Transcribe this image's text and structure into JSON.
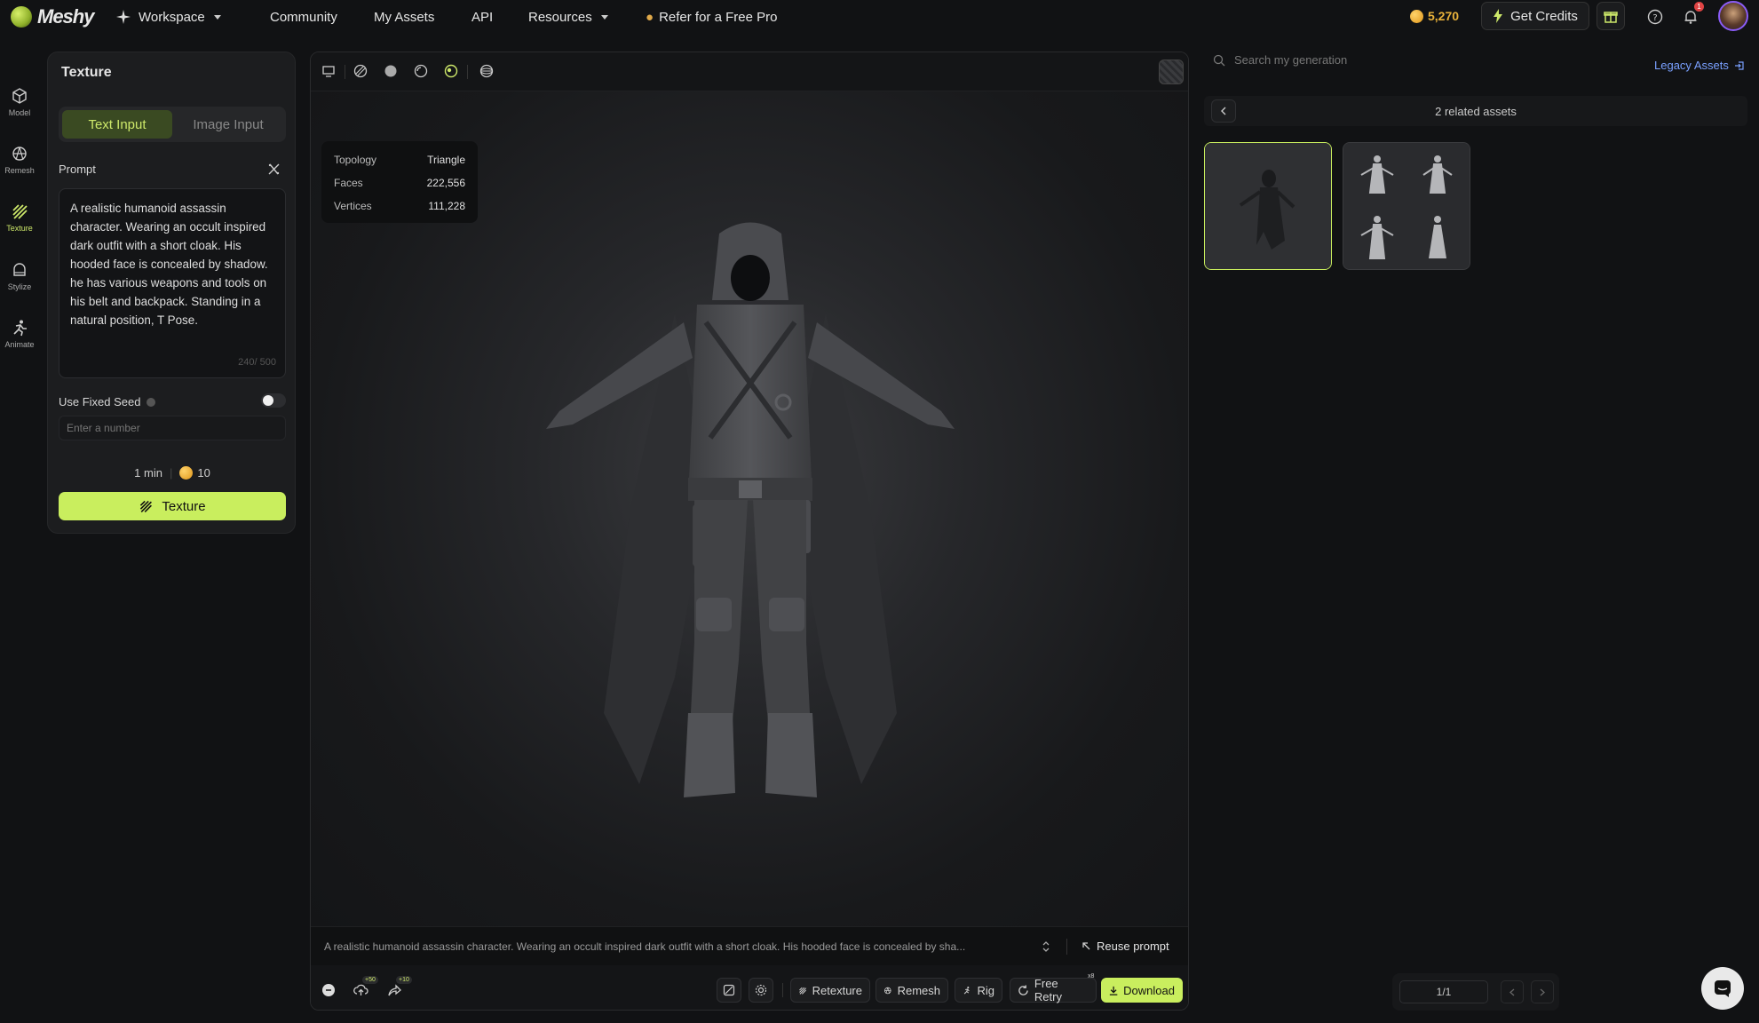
{
  "topbar": {
    "logo": "Meshy",
    "workspace": "Workspace",
    "nav": [
      "Community",
      "My Assets",
      "API",
      "Resources"
    ],
    "refer": "Refer for a Free Pro",
    "credits": "5,270",
    "get_credits": "Get Credits",
    "notif_count": "1"
  },
  "rail": [
    {
      "label": "Model",
      "icon": "cube-icon"
    },
    {
      "label": "Remesh",
      "icon": "remesh-icon"
    },
    {
      "label": "Texture",
      "icon": "texture-icon",
      "active": true
    },
    {
      "label": "Stylize",
      "icon": "stylize-icon"
    },
    {
      "label": "Animate",
      "icon": "animate-icon"
    }
  ],
  "panel": {
    "title": "Texture",
    "tabs": [
      "Text Input",
      "Image Input"
    ],
    "prompt_label": "Prompt",
    "prompt_text": "A realistic humanoid assassin character. Wearing an occult inspired dark outfit with a short cloak. His hooded face is concealed by shadow. he has various weapons and tools on his belt and backpack. Standing in a natural position,  T Pose.",
    "counter": "240/ 500",
    "seed_label": "Use Fixed Seed",
    "seed_placeholder": "Enter a number",
    "time": "1 min",
    "cost": "10",
    "button": "Texture"
  },
  "viewer": {
    "stats": [
      {
        "k": "Topology",
        "v": "Triangle"
      },
      {
        "k": "Faces",
        "v": "222,556"
      },
      {
        "k": "Vertices",
        "v": "111,228"
      }
    ],
    "bottom_prompt": "A realistic humanoid assassin character. Wearing an occult inspired dark outfit with a short cloak. His hooded face is concealed by sha...",
    "reuse": "Reuse prompt",
    "badge_a": "+50",
    "badge_b": "+10",
    "retry_badge": "x8",
    "buttons": {
      "retexture": "Retexture",
      "remesh": "Remesh",
      "rig": "Rig",
      "retry": "Free Retry",
      "download": "Download"
    }
  },
  "right": {
    "search_placeholder": "Search my generation",
    "legacy": "Legacy Assets",
    "related": "2 related assets",
    "pager": "1/1"
  },
  "colors": {
    "accent": "#c9ee5e",
    "link": "#7aa0ff",
    "coin": "#e9b23a"
  }
}
